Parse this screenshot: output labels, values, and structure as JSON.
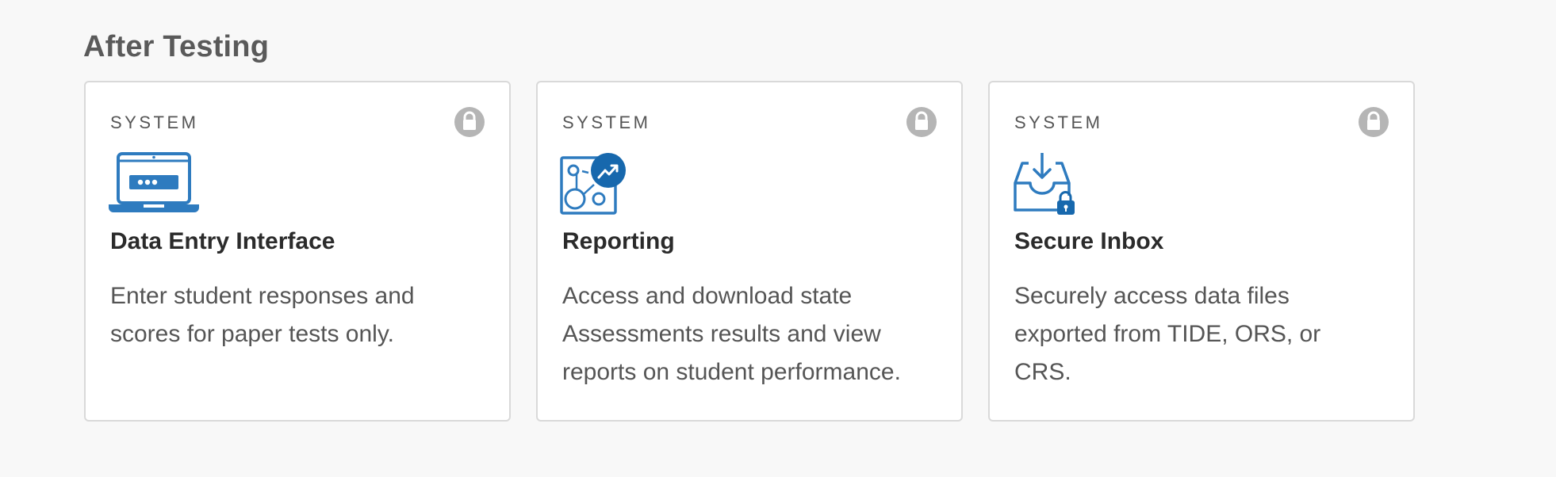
{
  "section": {
    "title": "After Testing"
  },
  "colors": {
    "icon_blue": "#2e7bbf",
    "icon_dark_blue": "#1768ad",
    "lock_gray": "#b5b5b5"
  },
  "cards": [
    {
      "category": "SYSTEM",
      "title": "Data Entry Interface",
      "description": "Enter student responses and scores for paper tests only.",
      "icon": "laptop-password-icon",
      "locked": true
    },
    {
      "category": "SYSTEM",
      "title": "Reporting",
      "description": "Access and download state Assessments results and view reports on student performance.",
      "icon": "reporting-chart-icon",
      "locked": true
    },
    {
      "category": "SYSTEM",
      "title": "Secure Inbox",
      "description": "Securely access data files exported from TIDE, ORS, or CRS.",
      "icon": "secure-inbox-icon",
      "locked": true
    }
  ]
}
